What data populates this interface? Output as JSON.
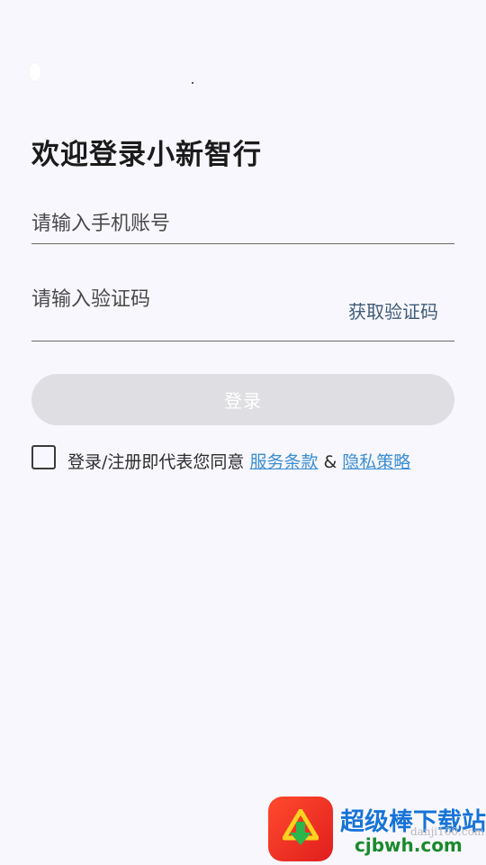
{
  "header": {
    "title": "欢迎登录小新智行"
  },
  "form": {
    "phone_placeholder": "请输入手机账号",
    "code_placeholder": "请输入验证码",
    "get_code_label": "获取验证码",
    "login_label": "登录"
  },
  "agreement": {
    "text": "登录/注册即代表您同意",
    "terms_link": "服务条款",
    "ampersand": "&",
    "privacy_link": "隐私策略",
    "checked": false
  },
  "watermark": {
    "title": "超级棒下载站",
    "site": "cjbwh.com",
    "site_small": "danji100.com"
  },
  "colors": {
    "background": "#f8f7fd",
    "link": "#3a8ed3",
    "get_code": "#3f5c78",
    "button_disabled": "#dfdfe3"
  }
}
